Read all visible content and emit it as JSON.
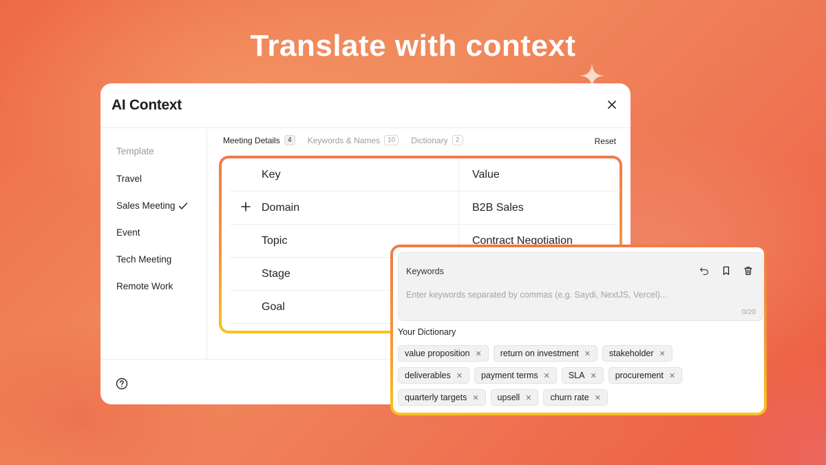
{
  "headline": "Translate with context",
  "panel": {
    "title": "AI Context",
    "close_icon": "close-icon"
  },
  "sidebar": {
    "heading": "Template",
    "items": [
      {
        "label": "Travel",
        "selected": false
      },
      {
        "label": "Sales Meeting",
        "selected": true
      },
      {
        "label": "Event",
        "selected": false
      },
      {
        "label": "Tech Meeting",
        "selected": false
      },
      {
        "label": "Remote Work",
        "selected": false
      }
    ]
  },
  "tabs": [
    {
      "label": "Meeting Details",
      "count": "4",
      "active": true
    },
    {
      "label": "Keywords & Names",
      "count": "10",
      "active": false
    },
    {
      "label": "Dictionary",
      "count": "2",
      "active": false
    }
  ],
  "reset_label": "Reset",
  "table": {
    "headers": {
      "key": "Key",
      "value": "Value"
    },
    "rows": [
      {
        "key": "Domain",
        "value": "B2B Sales"
      },
      {
        "key": "Topic",
        "value": "Contract Negotiation"
      },
      {
        "key": "Stage",
        "value": ""
      },
      {
        "key": "Goal",
        "value": ""
      }
    ]
  },
  "keywords": {
    "title": "Keywords",
    "placeholder": "Enter keywords separated by commas (e.g. Saydi, NextJS, Vercel)...",
    "counter": "0/20",
    "actions": [
      "undo-icon",
      "bookmark-icon",
      "trash-icon"
    ]
  },
  "dictionary": {
    "title": "Your Dictionary",
    "rows": [
      [
        "value proposition",
        "return on investment",
        "stakeholder"
      ],
      [
        "deliverables",
        "payment terms",
        "SLA",
        "procurement"
      ],
      [
        "quarterly targets",
        "upsell",
        "churn rate"
      ]
    ]
  },
  "colors": {
    "accent_orange": "#f07a4a",
    "accent_yellow": "#f8c21e",
    "background": "#ee6a45"
  }
}
